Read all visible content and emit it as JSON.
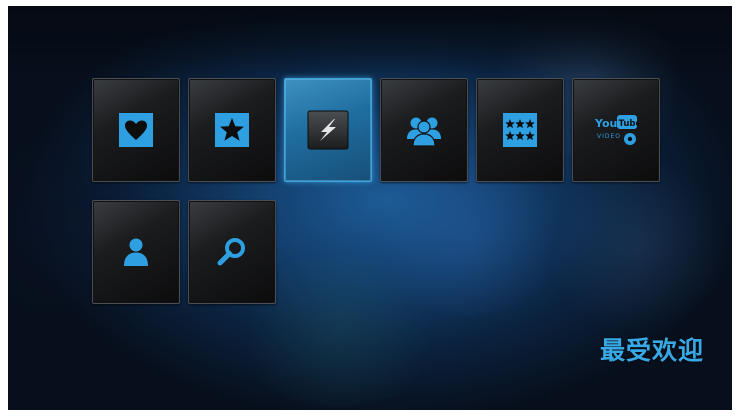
{
  "menu": {
    "row1": [
      {
        "icon": "heart-icon",
        "label": ""
      },
      {
        "icon": "star-icon",
        "label": ""
      },
      {
        "icon": "flash-icon",
        "label": "",
        "selected": true
      },
      {
        "icon": "group-icon",
        "label": ""
      },
      {
        "icon": "rating-stars-icon",
        "label": ""
      },
      {
        "icon": "youtube-icon",
        "label": "",
        "badge_text": [
          "You",
          "Tube",
          "VIDEO"
        ]
      }
    ],
    "row2": [
      {
        "icon": "person-icon",
        "label": ""
      },
      {
        "icon": "search-icon",
        "label": ""
      }
    ]
  },
  "section_title": "最受欢迎",
  "colors": {
    "accent": "#39a9e6",
    "icon_blue": "#2e9fe0",
    "tile_dark": "#141516",
    "background": "#0f3360"
  }
}
